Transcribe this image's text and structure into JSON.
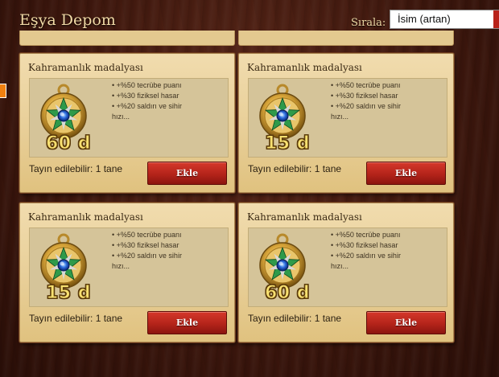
{
  "header": {
    "title": "Eşya Depom",
    "sort_label": "Sırala:",
    "sort_value": "İsim (artan)"
  },
  "cards": [
    {
      "name": "Kahramanlık madalyası",
      "duration": "60 d",
      "bonuses": [
        "• +%50 tecrübe puanı",
        "• +%30 fiziksel hasar",
        "• +%20 saldırı ve sihir",
        "hızı..."
      ],
      "assign_text": "Tayın edilebilir: 1 tane",
      "button_label": "Ekle"
    },
    {
      "name": "Kahramanlık madalyası",
      "duration": "15 d",
      "bonuses": [
        "• +%50 tecrübe puanı",
        "• +%30 fiziksel hasar",
        "• +%20 saldırı ve sihir",
        "hızı..."
      ],
      "assign_text": "Tayın edilebilir: 1 tane",
      "button_label": "Ekle"
    },
    {
      "name": "Kahramanlık madalyası",
      "duration": "15 d",
      "bonuses": [
        "• +%50 tecrübe puanı",
        "• +%30 fiziksel hasar",
        "• +%20 saldırı ve sihir",
        "hızı..."
      ],
      "assign_text": "Tayın edilebilir: 1 tane",
      "button_label": "Ekle"
    },
    {
      "name": "Kahramanlık madalyası",
      "duration": "60 d",
      "bonuses": [
        "• +%50 tecrübe puanı",
        "• +%30 fiziksel hasar",
        "• +%20 saldırı ve sihir",
        "hızı..."
      ],
      "assign_text": "Tayın edilebilir: 1 tane",
      "button_label": "Ekle"
    }
  ],
  "icons": {
    "medal": "heroism-medal-icon"
  },
  "colors": {
    "button_red": "#b4241a",
    "parchment": "#e7cd95",
    "duration_gold": "#f8e070"
  }
}
